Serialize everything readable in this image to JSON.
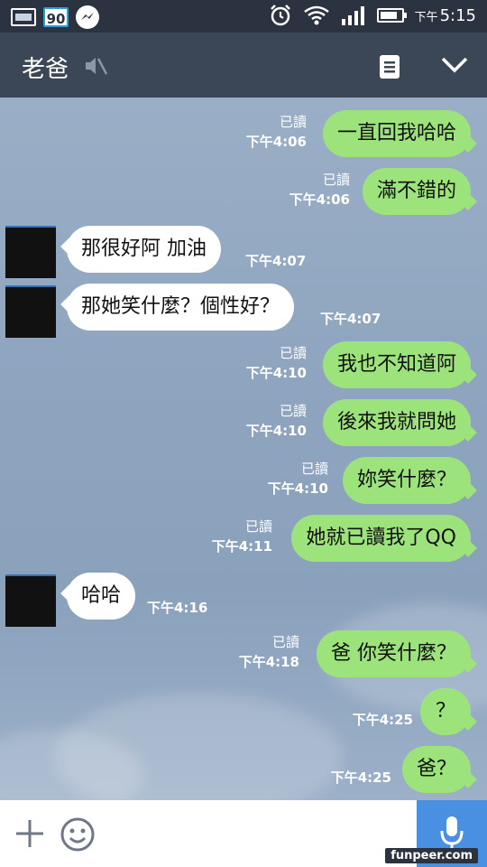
{
  "status_bar": {
    "badge_number": "90",
    "time_prefix": "下午",
    "time": "5:15"
  },
  "header": {
    "title": "老爸",
    "icons": [
      "mute-icon",
      "notes-icon",
      "chevron-down-icon"
    ]
  },
  "messages": [
    {
      "side": "me",
      "text": "一直回我哈哈",
      "read": "已讀",
      "time": "下午4:06"
    },
    {
      "side": "me",
      "text": "滿不錯的",
      "read": "已讀",
      "time": "下午4:06"
    },
    {
      "side": "them",
      "text": "那很好阿  加油",
      "time": "下午4:07"
    },
    {
      "side": "them",
      "text": "那她笑什麼？個性好？",
      "time": "下午4:07"
    },
    {
      "side": "me",
      "text": "我也不知道阿",
      "read": "已讀",
      "time": "下午4:10"
    },
    {
      "side": "me",
      "text": "後來我就問她",
      "read": "已讀",
      "time": "下午4:10"
    },
    {
      "side": "me",
      "text": "妳笑什麼？",
      "read": "已讀",
      "time": "下午4:10"
    },
    {
      "side": "me",
      "text": "她就已讀我了QQ",
      "read": "已讀",
      "time": "下午4:11"
    },
    {
      "side": "them",
      "text": "哈哈",
      "time": "下午4:16"
    },
    {
      "side": "me",
      "text": "爸 你笑什麼？",
      "read": "已讀",
      "time": "下午4:18"
    },
    {
      "side": "me",
      "text": "？",
      "read": "",
      "time": "下午4:25"
    },
    {
      "side": "me",
      "text": "爸？",
      "read": "",
      "time": "下午4:25"
    }
  ],
  "input_bar": {
    "icons": [
      "plus-icon",
      "smile-icon",
      "mic-icon"
    ]
  },
  "watermark": "funpeer.com",
  "colors": {
    "my_bubble": "#9de37b",
    "their_bubble": "#ffffff",
    "header": "#3b4656",
    "mic_button": "#4a90e2"
  }
}
